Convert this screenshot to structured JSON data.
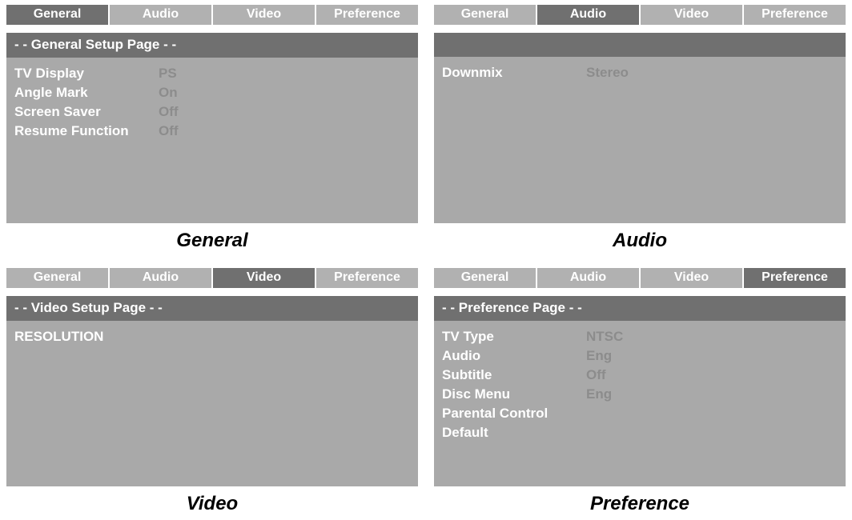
{
  "tabs": [
    "General",
    "Audio",
    "Video",
    "Preference"
  ],
  "panels": [
    {
      "activeTab": 0,
      "header": "- -   General Setup Page   - -",
      "rows": [
        {
          "label": "TV Display",
          "value": "PS"
        },
        {
          "label": "Angle Mark",
          "value": "On"
        },
        {
          "label": "Screen Saver",
          "value": "Off"
        },
        {
          "label": "Resume Function",
          "value": "Off"
        }
      ],
      "caption": "General"
    },
    {
      "activeTab": 1,
      "header": "",
      "rows": [
        {
          "label": "Downmix",
          "value": "Stereo"
        }
      ],
      "caption": "Audio"
    },
    {
      "activeTab": 2,
      "header": "- -   Video Setup Page   - -",
      "rows": [
        {
          "label": "RESOLUTION",
          "value": ""
        }
      ],
      "caption": "Video"
    },
    {
      "activeTab": 3,
      "header": "- -   Preference Page   - -",
      "rows": [
        {
          "label": "TV Type",
          "value": "NTSC"
        },
        {
          "label": "Audio",
          "value": "Eng"
        },
        {
          "label": "Subtitle",
          "value": "Off"
        },
        {
          "label": "Disc Menu",
          "value": "Eng"
        },
        {
          "label": "Parental Control",
          "value": ""
        },
        {
          "label": "Default",
          "value": ""
        }
      ],
      "caption": "Preference"
    }
  ]
}
